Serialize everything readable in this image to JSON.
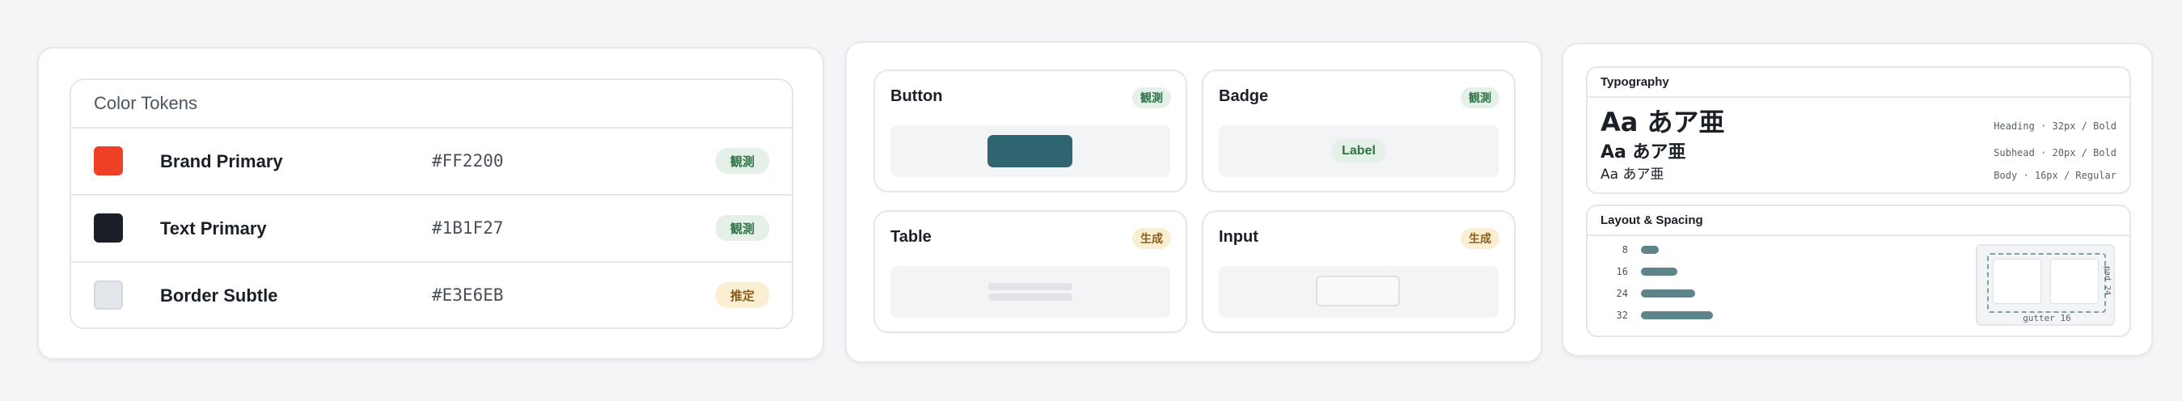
{
  "color_tokens": {
    "title": "Color Tokens",
    "rows": [
      {
        "name": "Brand Primary",
        "hex": "#FF2200",
        "swatch": "#EE4027",
        "status": "観測",
        "status_kind": "observed"
      },
      {
        "name": "Text Primary",
        "hex": "#1B1F27",
        "swatch": "#1B1F27",
        "status": "観測",
        "status_kind": "observed"
      },
      {
        "name": "Border Subtle",
        "hex": "#E3E6EB",
        "swatch": "#E3E6EB",
        "status": "推定",
        "status_kind": "inferred"
      }
    ]
  },
  "components": {
    "button": {
      "title": "Button",
      "status": "観測"
    },
    "badge": {
      "title": "Badge",
      "status": "観測",
      "demo_label": "Label"
    },
    "table": {
      "title": "Table",
      "status": "生成"
    },
    "input": {
      "title": "Input",
      "status": "生成"
    }
  },
  "typography": {
    "title": "Typography",
    "samples": [
      {
        "text": "Aa あア亜",
        "meta": "Heading · 32px / Bold"
      },
      {
        "text": "Aa あア亜",
        "meta": "Subhead · 20px / Bold"
      },
      {
        "text": "Aa あア亜",
        "meta": "Body · 16px / Regular"
      }
    ]
  },
  "layout_spacing": {
    "title": "Layout & Spacing",
    "scale": [
      "8",
      "16",
      "24",
      "32"
    ],
    "gutter_label": "gutter 16",
    "pad_label": "pad 24"
  },
  "colors": {
    "observed_bg": "#E5F1E8",
    "observed_text": "#2F7246",
    "inferred_bg": "#FAEFD3",
    "inferred_text": "#8A5E1D",
    "accent": "#2F6570",
    "spacing_bar": "#5C8489"
  }
}
